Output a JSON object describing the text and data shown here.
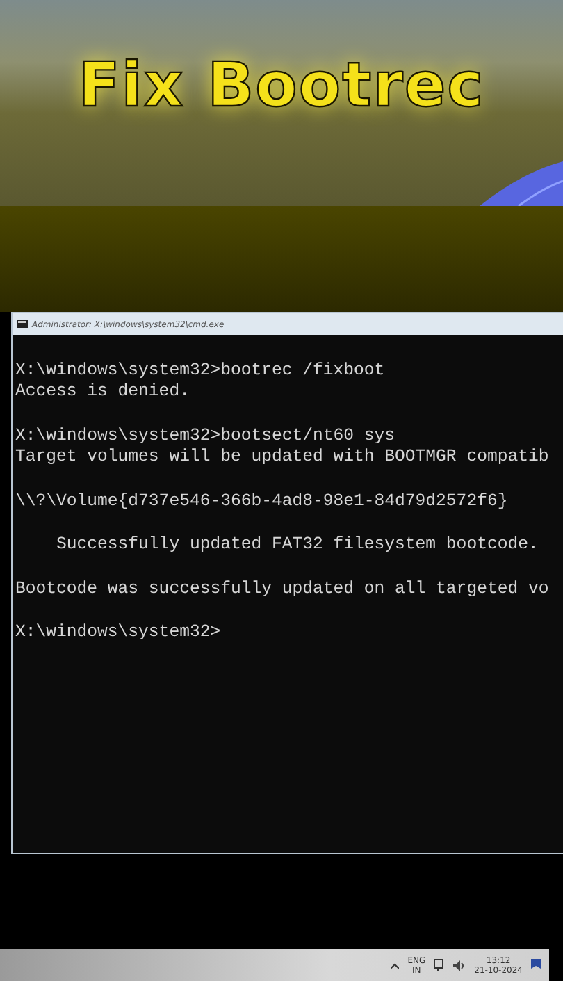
{
  "headline": "Fix Bootrec",
  "window": {
    "title": "Administrator: X:\\windows\\system32\\cmd.exe"
  },
  "console_blocks": [
    [
      "X:\\windows\\system32>bootrec /fixboot",
      "Access is denied."
    ],
    [
      "X:\\windows\\system32>bootsect/nt60 sys",
      "Target volumes will be updated with BOOTMGR compatib"
    ],
    [
      "\\\\?\\Volume{d737e546-366b-4ad8-98e1-84d79d2572f6}"
    ],
    [
      "    Successfully updated FAT32 filesystem bootcode."
    ],
    [
      "Bootcode was successfully updated on all targeted vo"
    ],
    [
      "X:\\windows\\system32>"
    ]
  ],
  "taskbar": {
    "language": "ENG",
    "region": "IN",
    "time": "13:12",
    "date": "21-10-2024"
  }
}
